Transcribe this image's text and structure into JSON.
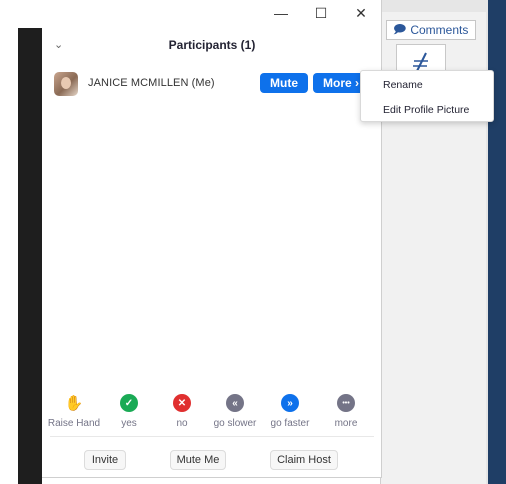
{
  "background_app": {
    "comments_label": "Comments"
  },
  "window": {
    "minimize_glyph": "—",
    "maximize_glyph": "☐",
    "close_glyph": "✕"
  },
  "panel": {
    "title": "Participants (1)",
    "collapse_glyph": "⌄"
  },
  "participant": {
    "name": "JANICE MCMILLEN (Me)",
    "mute_label": "Mute",
    "more_label": "More ›"
  },
  "menu": {
    "items": [
      "Rename",
      "Edit Profile Picture"
    ]
  },
  "reactions": [
    {
      "label": "Raise Hand",
      "icon": "raise-hand-icon",
      "color": "#0e71eb",
      "glyph": "✋"
    },
    {
      "label": "yes",
      "icon": "check-icon",
      "color": "#1aaa55",
      "glyph": "✓"
    },
    {
      "label": "no",
      "icon": "x-icon",
      "color": "#e02f2f",
      "glyph": "✕"
    },
    {
      "label": "go slower",
      "icon": "go-slower-icon",
      "color": "#747487",
      "glyph": "«"
    },
    {
      "label": "go faster",
      "icon": "go-faster-icon",
      "color": "#0e71eb",
      "glyph": "»"
    },
    {
      "label": "more",
      "icon": "more-dots-icon",
      "color": "#747487",
      "glyph": "•••"
    }
  ],
  "footer": {
    "invite_label": "Invite",
    "mute_me_label": "Mute Me",
    "claim_host_label": "Claim Host"
  }
}
